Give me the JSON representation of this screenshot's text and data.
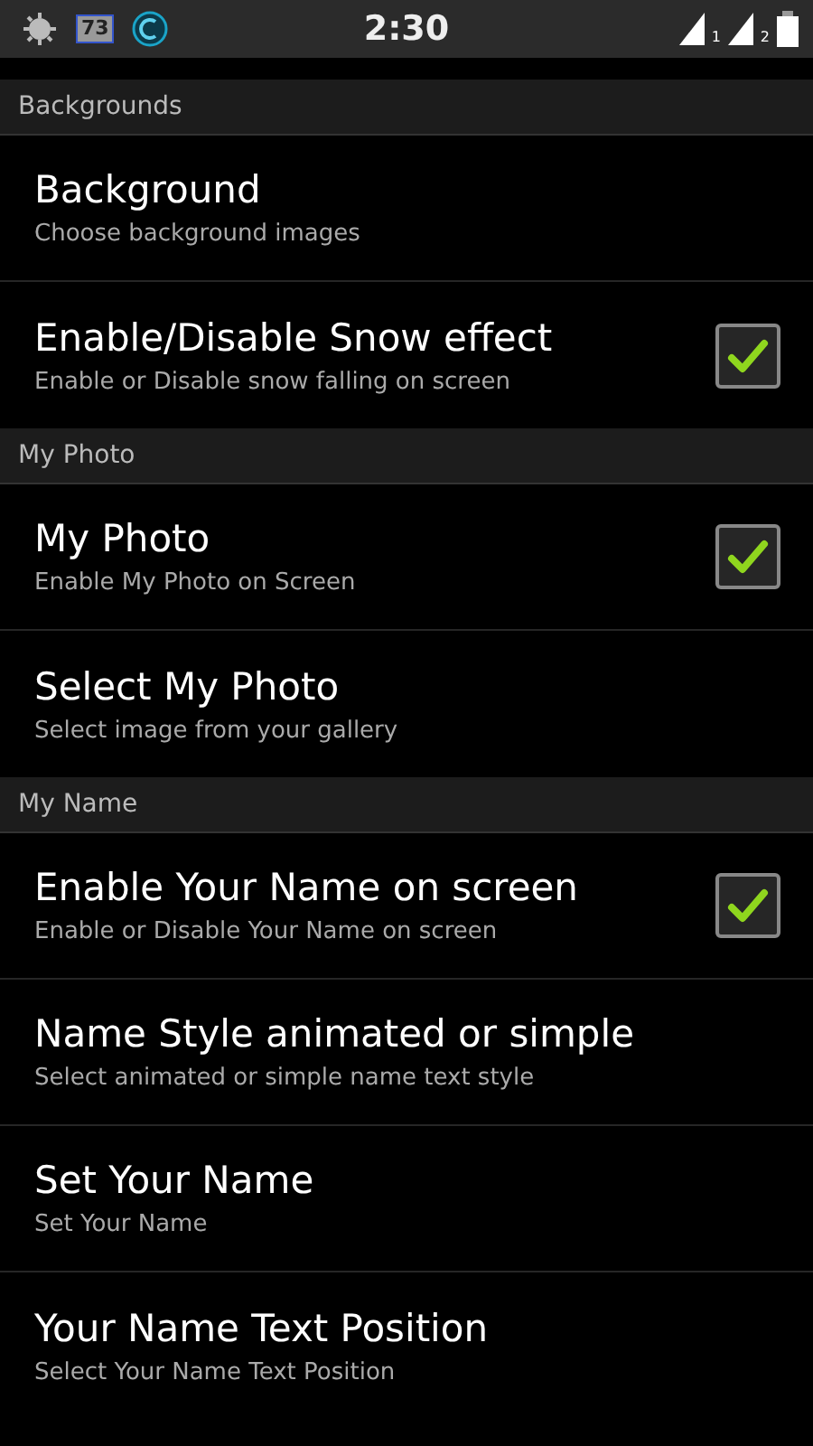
{
  "status_bar": {
    "badge": "73",
    "time": "2:30",
    "sim_labels": [
      "1",
      "2"
    ]
  },
  "sections": [
    {
      "header": "Backgrounds",
      "items": [
        {
          "kind": "plain",
          "title": "Background",
          "summary": "Choose background images"
        },
        {
          "kind": "checkbox",
          "title": "Enable/Disable Snow effect",
          "summary": "Enable or Disable snow falling on screen",
          "checked": true
        }
      ]
    },
    {
      "header": "My Photo",
      "items": [
        {
          "kind": "checkbox",
          "title": "My Photo",
          "summary": "Enable My Photo on Screen",
          "checked": true
        },
        {
          "kind": "plain",
          "title": "Select My Photo",
          "summary": "Select image from your gallery"
        }
      ]
    },
    {
      "header": "My Name",
      "items": [
        {
          "kind": "checkbox",
          "title": "Enable Your Name on screen",
          "summary": "Enable or Disable Your Name on screen",
          "checked": true
        },
        {
          "kind": "plain",
          "title": "Name Style animated or simple",
          "summary": "Select animated or simple name text style"
        },
        {
          "kind": "plain",
          "title": "Set Your Name",
          "summary": "Set Your Name"
        },
        {
          "kind": "plain",
          "title": "Your Name Text Position",
          "summary": "Select Your Name Text Position"
        }
      ]
    }
  ]
}
